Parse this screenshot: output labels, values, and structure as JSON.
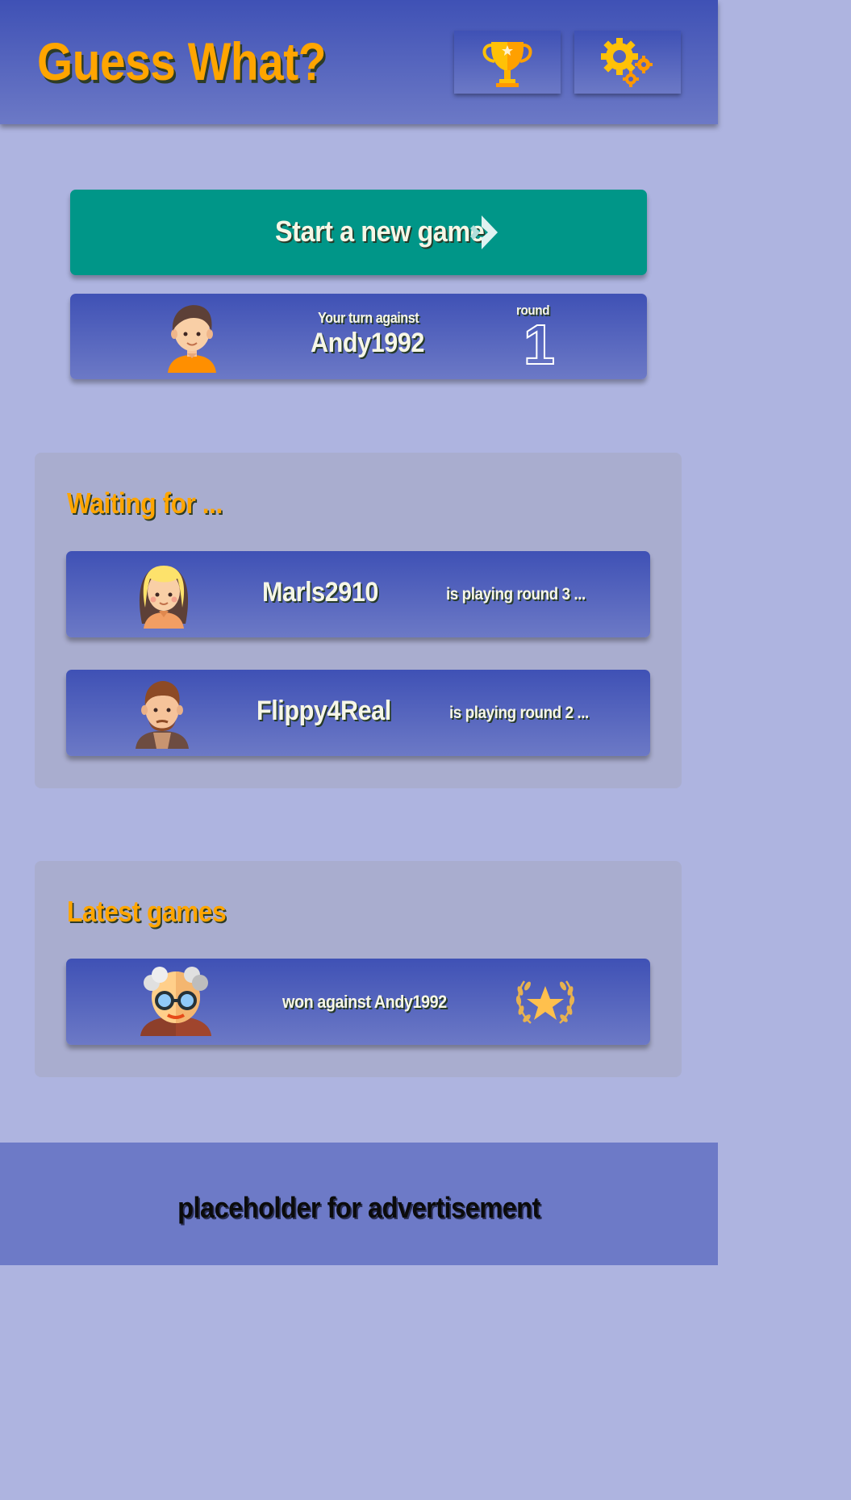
{
  "app": {
    "title": "Guess What?"
  },
  "header": {
    "trophy_icon": "trophy-icon",
    "settings_icon": "gear-icon"
  },
  "start_game": {
    "label": "Start a new game",
    "icon": "double-chevron-right-icon"
  },
  "current_turn": {
    "caption": "Your turn against",
    "opponent": "Andy1992",
    "round_label": "round",
    "round": "1"
  },
  "waiting": {
    "title": "Waiting for ...",
    "items": [
      {
        "name": "Marls2910",
        "status": "is playing round 3 ..."
      },
      {
        "name": "Flippy4Real",
        "status": "is playing round 2 ..."
      }
    ]
  },
  "latest": {
    "title": "Latest games",
    "items": [
      {
        "text": "won against Andy1992",
        "icon": "star-laurel-icon"
      }
    ]
  },
  "footer": {
    "ad": "placeholder for advertisement"
  },
  "colors": {
    "primary": "#3f51b5",
    "accent_orange": "#ffa500",
    "teal": "#009688",
    "background": "#aeb4e0"
  }
}
